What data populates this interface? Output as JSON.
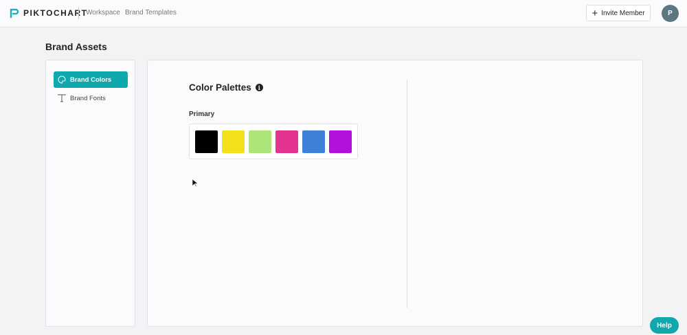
{
  "header": {
    "logo": "PIKTOCHART",
    "nav": [
      "Workspace",
      "Brand Templates"
    ],
    "invite_label": "Invite Member",
    "avatar_initial": "P"
  },
  "page_title": "Brand Assets",
  "sidebar": {
    "items": [
      {
        "label": "Brand Colors",
        "active": true
      },
      {
        "label": "Brand Fonts",
        "active": false
      }
    ]
  },
  "main": {
    "title": "Color Palettes",
    "palette_label": "Primary",
    "swatches": [
      "#000000",
      "#f2e11a",
      "#aee57a",
      "#e3358f",
      "#3f80d8",
      "#b011dc"
    ]
  },
  "help_label": "Help",
  "colors": {
    "accent": "#0fa8ad"
  }
}
